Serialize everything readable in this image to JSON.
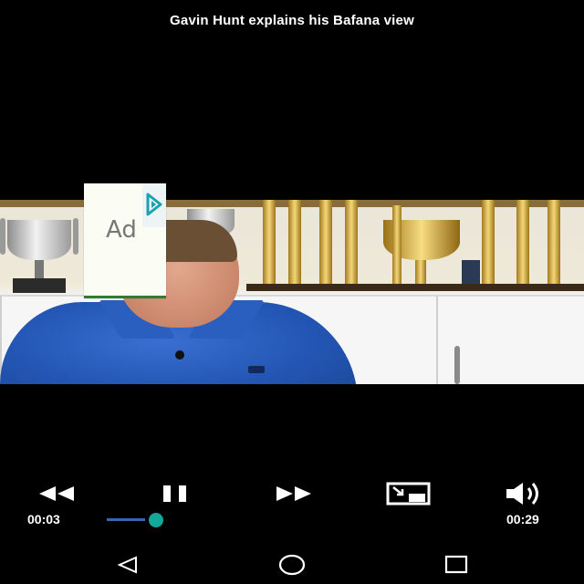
{
  "video": {
    "title": "Gavin Hunt explains his Bafana view",
    "ad_label": "Ad"
  },
  "controls": {
    "current_time": "00:03",
    "duration": "00:29",
    "progress_fraction": 0.103
  },
  "icons": {
    "rewind": "rewind-icon",
    "pause": "pause-icon",
    "fast_forward": "fast-forward-icon",
    "picture_in_picture": "picture-in-picture-icon",
    "volume": "volume-icon",
    "ad_choices": "ad-choices-icon",
    "nav_back": "back-icon",
    "nav_home": "home-icon",
    "nav_recents": "recents-icon"
  },
  "colors": {
    "background": "#000000",
    "progress_thumb": "#13a89a",
    "text": "#ffffff"
  }
}
